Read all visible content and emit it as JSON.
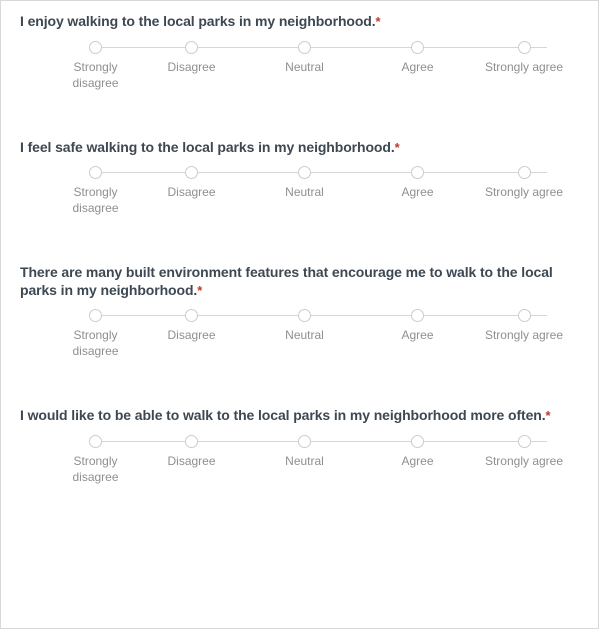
{
  "form": {
    "required_marker": "*",
    "accent_colors": {
      "question_text": "#3d4852",
      "required_asterisk": "#c0392b",
      "scale_label": "#8f8f8f",
      "circle_outline": "#cccccc",
      "track_line": "#d6d6d6",
      "page_border": "#d8d8d8",
      "background": "#ffffff"
    },
    "scale_labels": [
      "Strongly\ndisagree",
      "Disagree",
      "Neutral",
      "Agree",
      "Strongly agree"
    ],
    "questions": [
      {
        "id": "q1",
        "text": "I enjoy walking to the local parks in my neighborhood.",
        "required": true,
        "selected": null
      },
      {
        "id": "q2",
        "text": "I feel safe walking to the local parks in my neighborhood.",
        "required": true,
        "selected": null
      },
      {
        "id": "q3",
        "text": "There are many built environment features that encourage me to walk to the local parks in my neighborhood.",
        "required": true,
        "selected": null
      },
      {
        "id": "q4",
        "text": "I would like to be able to walk to the local parks in my neighborhood more often.",
        "required": true,
        "selected": null
      }
    ]
  }
}
